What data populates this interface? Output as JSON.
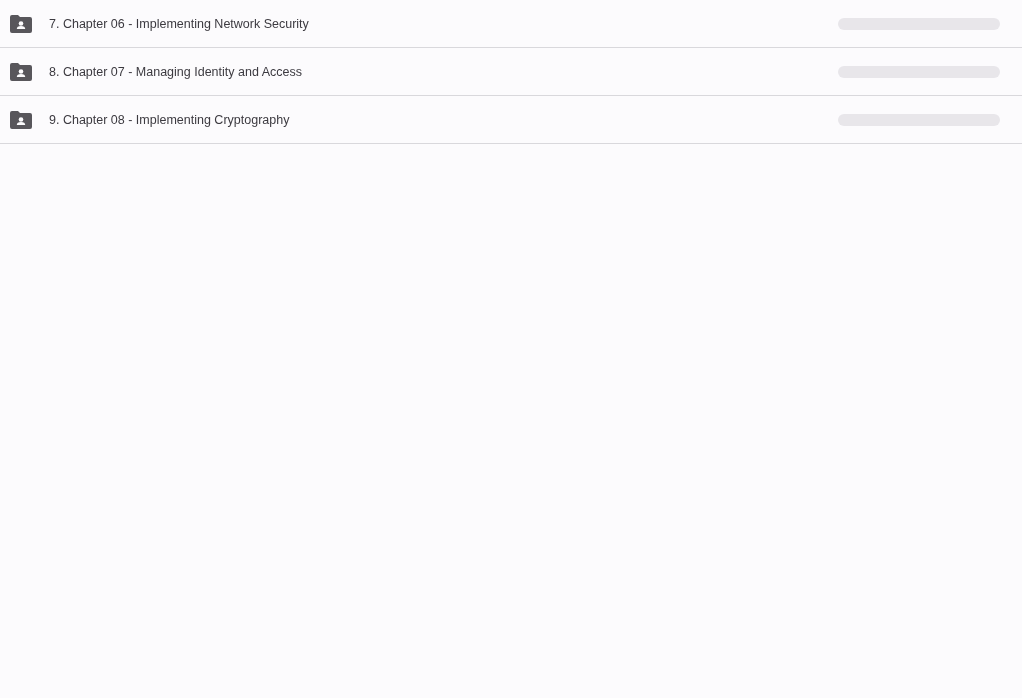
{
  "folders": [
    {
      "title": "7. Chapter 06 - Implementing Network Security"
    },
    {
      "title": "8. Chapter 07 - Managing Identity and Access"
    },
    {
      "title": "9. Chapter 08 - Implementing Cryptography"
    }
  ]
}
